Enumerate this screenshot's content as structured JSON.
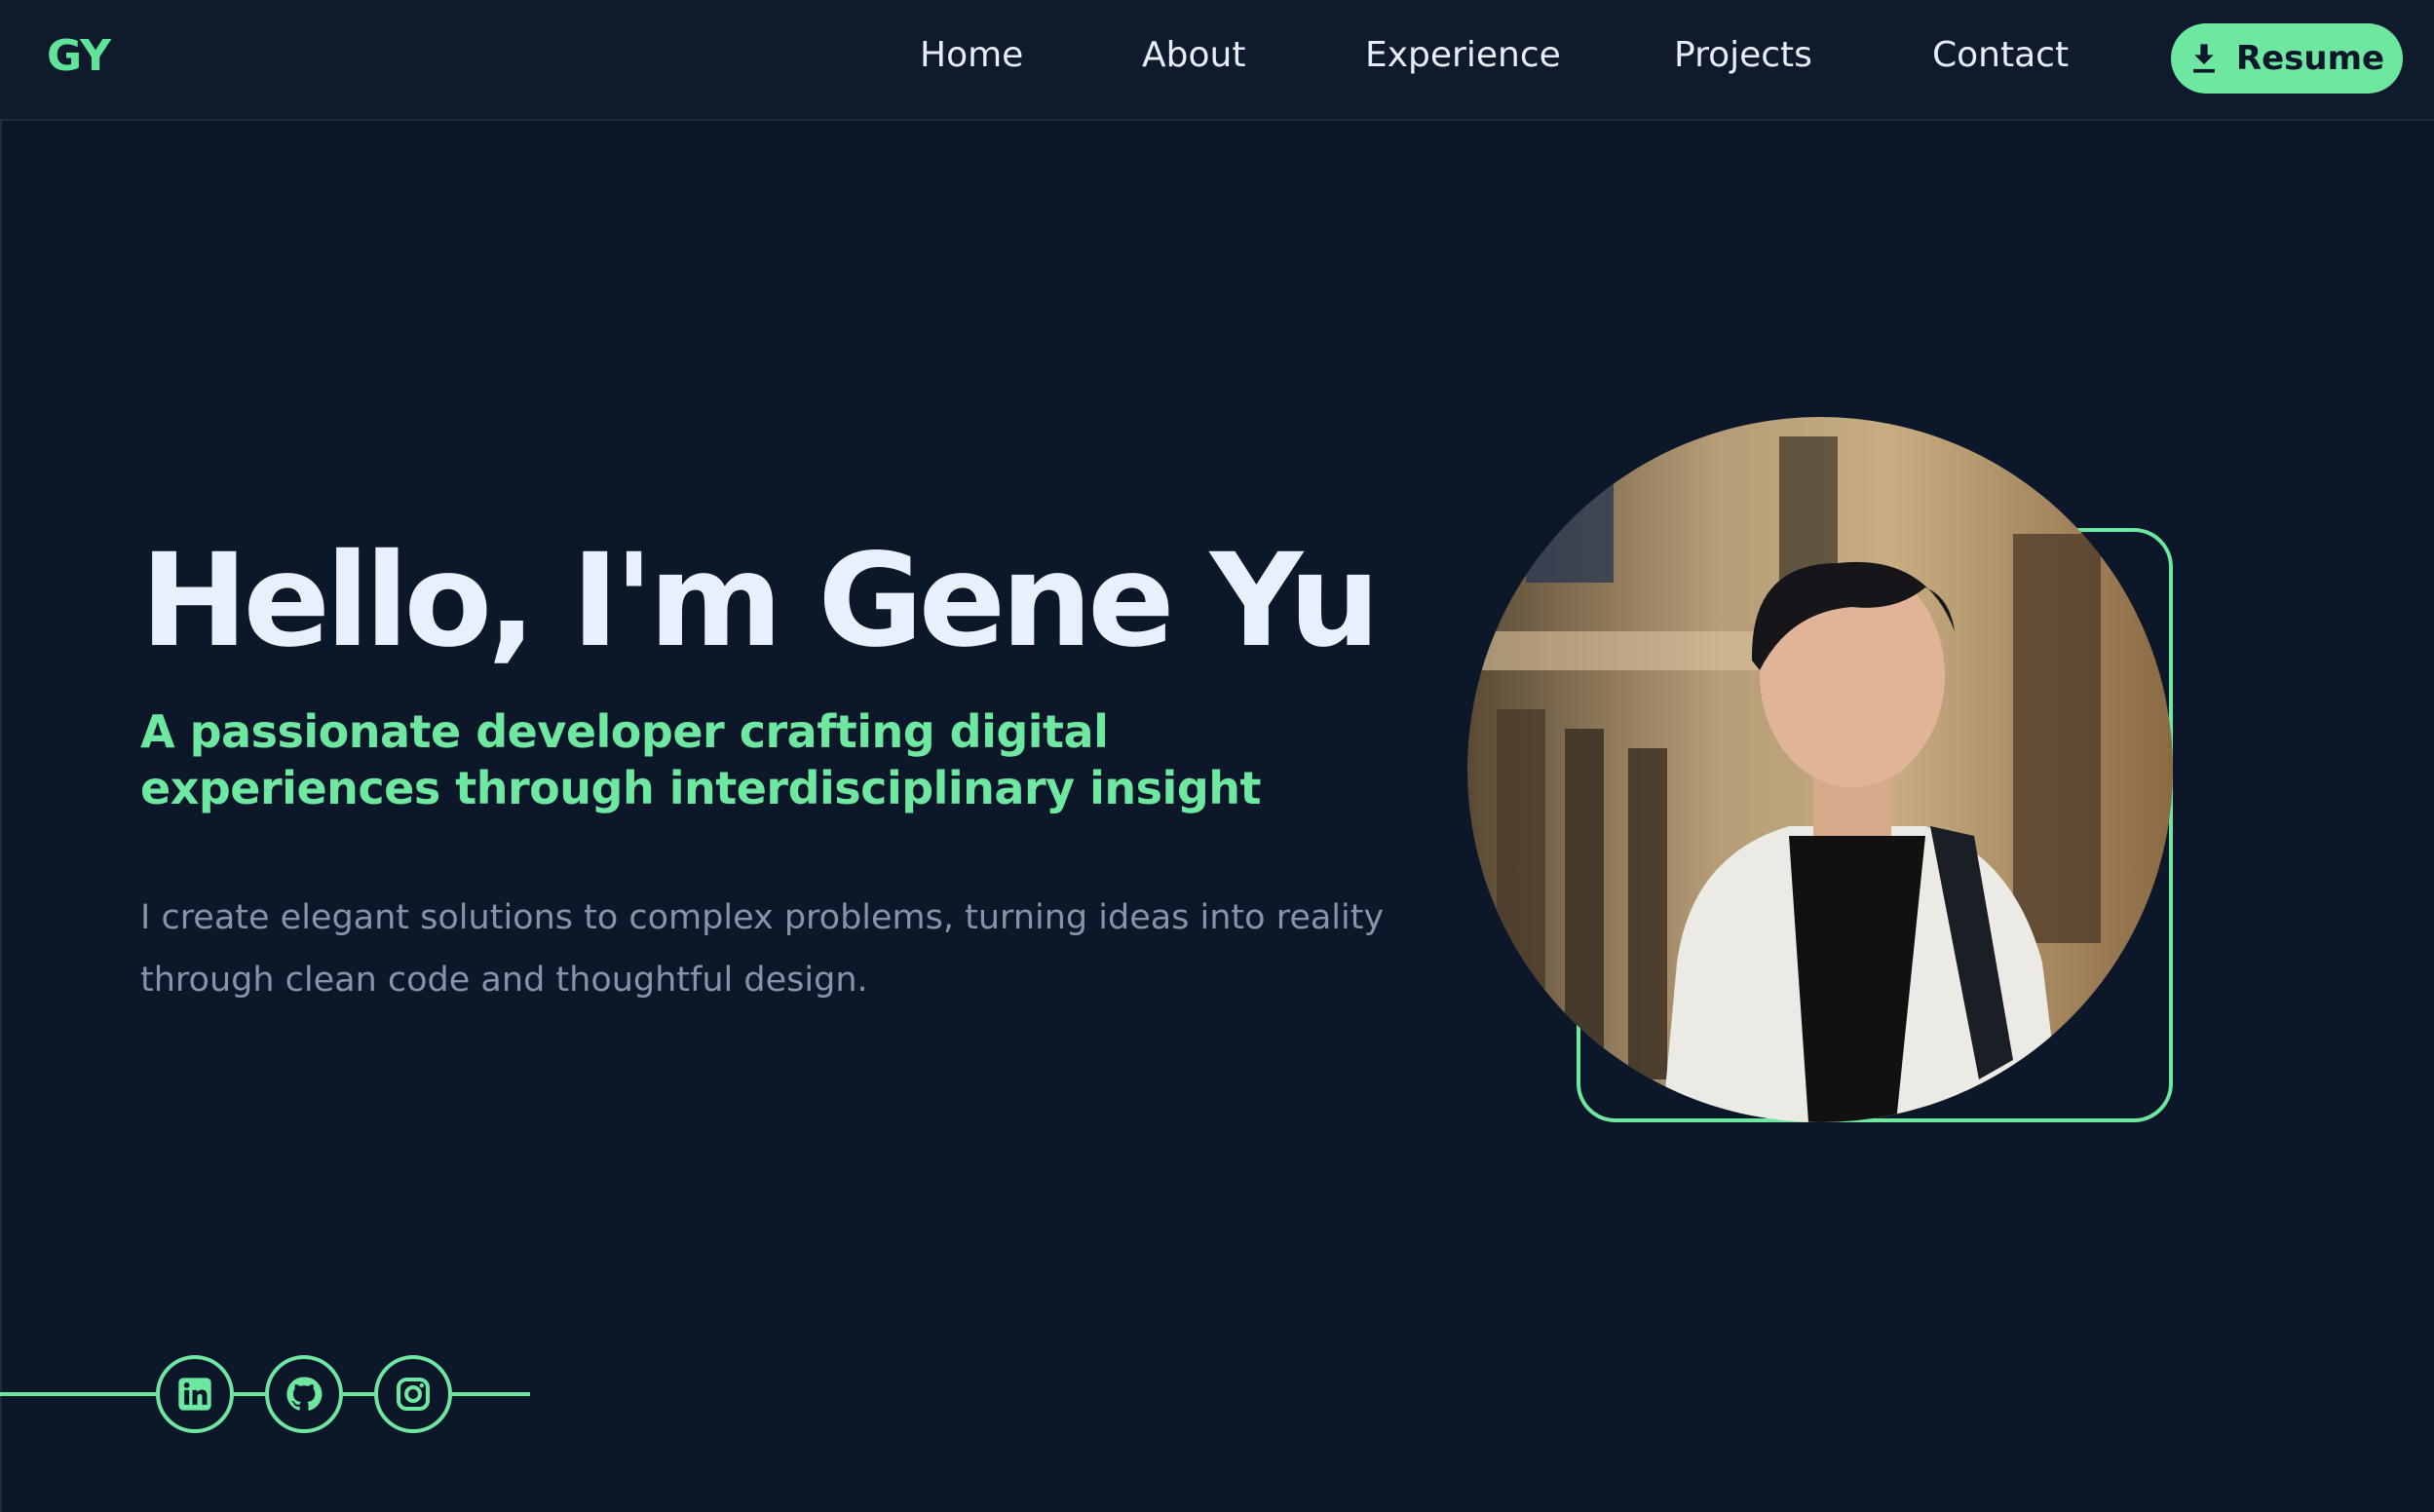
{
  "nav": {
    "logo": "GY",
    "links": [
      "Home",
      "About",
      "Experience",
      "Projects",
      "Contact"
    ],
    "resume_label": "Resume",
    "resume_icon": "download-icon"
  },
  "hero": {
    "title": "Hello, I'm Gene Yu",
    "subtitle": "A passionate developer crafting digital experiences through interdisciplinary insight",
    "description": "I create elegant solutions to complex problems, turning ideas into reality through clean code and thoughtful design."
  },
  "social": [
    "linkedin-icon",
    "github-icon",
    "instagram-icon"
  ],
  "colors": {
    "background": "#0d172a",
    "accent": "#6ee7a0",
    "heading": "#e7f0fc",
    "muted": "#8593ab"
  }
}
